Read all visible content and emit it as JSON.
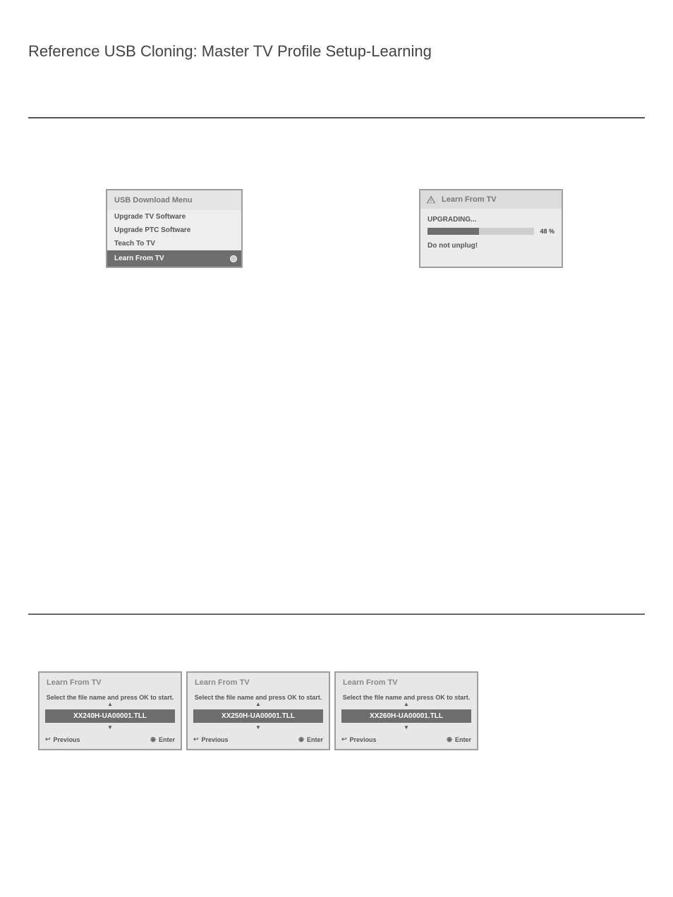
{
  "page": {
    "title": "Reference USB Cloning: Master TV Profile Setup-Learning"
  },
  "usb_menu": {
    "header": "USB Download Menu",
    "items": [
      {
        "label": "Upgrade TV Software",
        "selected": false
      },
      {
        "label": "Upgrade PTC Software",
        "selected": false
      },
      {
        "label": "Teach To TV",
        "selected": false
      },
      {
        "label": "Learn From TV",
        "selected": true
      }
    ]
  },
  "progress": {
    "header": "Learn From TV",
    "status": "UPGRADING...",
    "percent": 48,
    "percent_label": "48 %",
    "warning": "Do not unplug!"
  },
  "learn_panels": [
    {
      "header": "Learn From TV",
      "instruction": "Select the file name and press OK to start.",
      "up": "▲",
      "filename": "XX240H-UA00001.TLL",
      "down": "▼",
      "previous": "Previous",
      "enter": "Enter"
    },
    {
      "header": "Learn From TV",
      "instruction": "Select the file name and press OK to start.",
      "up": "▲",
      "filename": "XX250H-UA00001.TLL",
      "down": "▼",
      "previous": "Previous",
      "enter": "Enter"
    },
    {
      "header": "Learn From TV",
      "instruction": "Select the file name and press OK to start.",
      "up": "▲",
      "filename": "XX260H-UA00001.TLL",
      "down": "▼",
      "previous": "Previous",
      "enter": "Enter"
    }
  ]
}
